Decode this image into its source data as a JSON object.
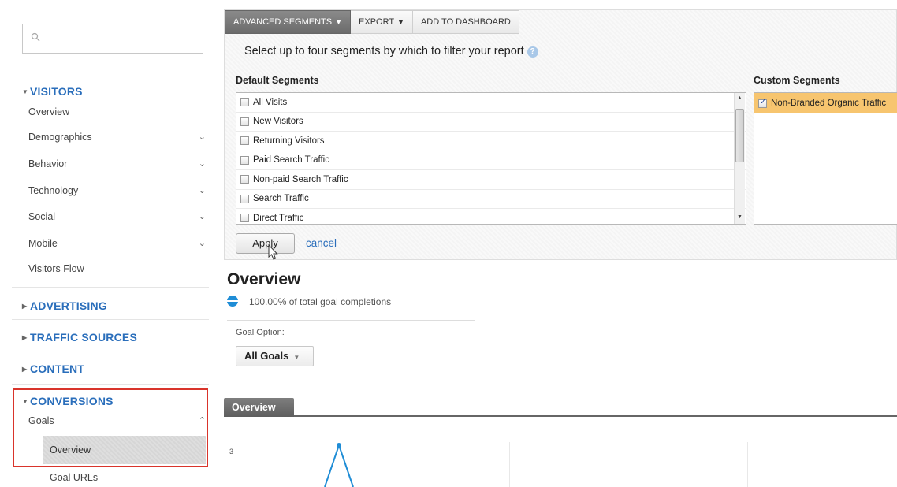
{
  "sidebar": {
    "search_placeholder": "",
    "sections": [
      {
        "label": "VISITORS",
        "expanded": true
      },
      {
        "label": "ADVERTISING",
        "expanded": false
      },
      {
        "label": "TRAFFIC SOURCES",
        "expanded": false
      },
      {
        "label": "CONTENT",
        "expanded": false
      },
      {
        "label": "CONVERSIONS",
        "expanded": true
      }
    ],
    "visitors_items": [
      {
        "label": "Overview"
      },
      {
        "label": "Demographics"
      },
      {
        "label": "Behavior"
      },
      {
        "label": "Technology"
      },
      {
        "label": "Social"
      },
      {
        "label": "Mobile"
      },
      {
        "label": "Visitors Flow"
      }
    ],
    "conversions_items": {
      "goals": "Goals",
      "goals_overview": "Overview",
      "goal_urls": "Goal URLs"
    }
  },
  "toolbar": {
    "advanced_segments": "ADVANCED SEGMENTS",
    "export": "EXPORT",
    "add_to_dashboard": "ADD TO DASHBOARD"
  },
  "segments": {
    "prompt": "Select up to four segments by which to filter your report",
    "help": "?",
    "default_title": "Default Segments",
    "custom_title": "Custom Segments",
    "default_list": [
      {
        "label": "All Visits",
        "checked": false
      },
      {
        "label": "New Visitors",
        "checked": false
      },
      {
        "label": "Returning Visitors",
        "checked": false
      },
      {
        "label": "Paid Search Traffic",
        "checked": false
      },
      {
        "label": "Non-paid Search Traffic",
        "checked": false
      },
      {
        "label": "Search Traffic",
        "checked": false
      },
      {
        "label": "Direct Traffic",
        "checked": false
      }
    ],
    "custom_list": [
      {
        "label": "Non-Branded Organic Traffic",
        "checked": true
      }
    ],
    "apply": "Apply",
    "cancel": "cancel"
  },
  "overview": {
    "title": "Overview",
    "stat": "100.00% of total goal completions",
    "goal_option_label": "Goal Option:",
    "goal_option_value": "All Goals",
    "tab": "Overview",
    "chart_ytick": "3"
  },
  "colors": {
    "link_blue": "#2a6ebb",
    "highlight_red": "#d9342b",
    "custom_selected": "#f7c56f",
    "chart_blue": "#1f8dd6"
  }
}
